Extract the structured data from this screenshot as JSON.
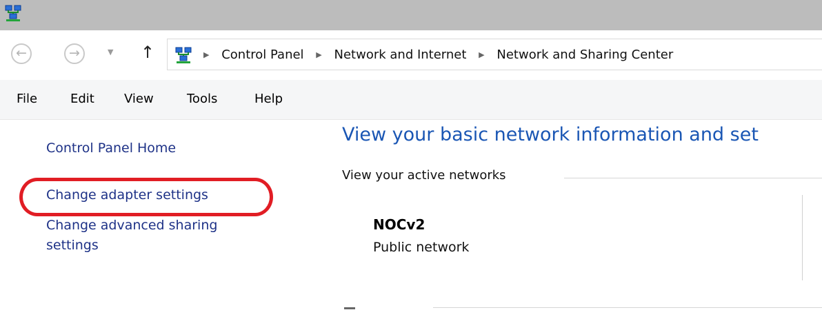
{
  "icons": {
    "app": "network-sharing-icon",
    "breadcrumb": "network-sharing-icon",
    "back": "back-arrow-icon",
    "forward": "forward-arrow-icon",
    "recent": "chevron-down-icon",
    "up": "up-arrow-icon",
    "separator": "breadcrumb-separator-icon"
  },
  "address": {
    "crumbs": [
      "Control Panel",
      "Network and Internet",
      "Network and Sharing Center"
    ]
  },
  "menu": {
    "items": [
      "File",
      "Edit",
      "View",
      "Tools",
      "Help"
    ]
  },
  "sidebar": {
    "items": [
      {
        "label": "Control Panel Home"
      },
      {
        "label": "Change adapter settings",
        "highlighted": true
      },
      {
        "label": "Change advanced sharing settings"
      }
    ]
  },
  "main": {
    "title": "View your basic network information and set",
    "active_networks_label": "View your active networks",
    "network": {
      "name": "NOCv2",
      "type": "Public network"
    }
  },
  "colors": {
    "link": "#1e3287",
    "title": "#1a56b4",
    "highlight": "#e11d24",
    "titlebar": "#bcbcbc"
  }
}
